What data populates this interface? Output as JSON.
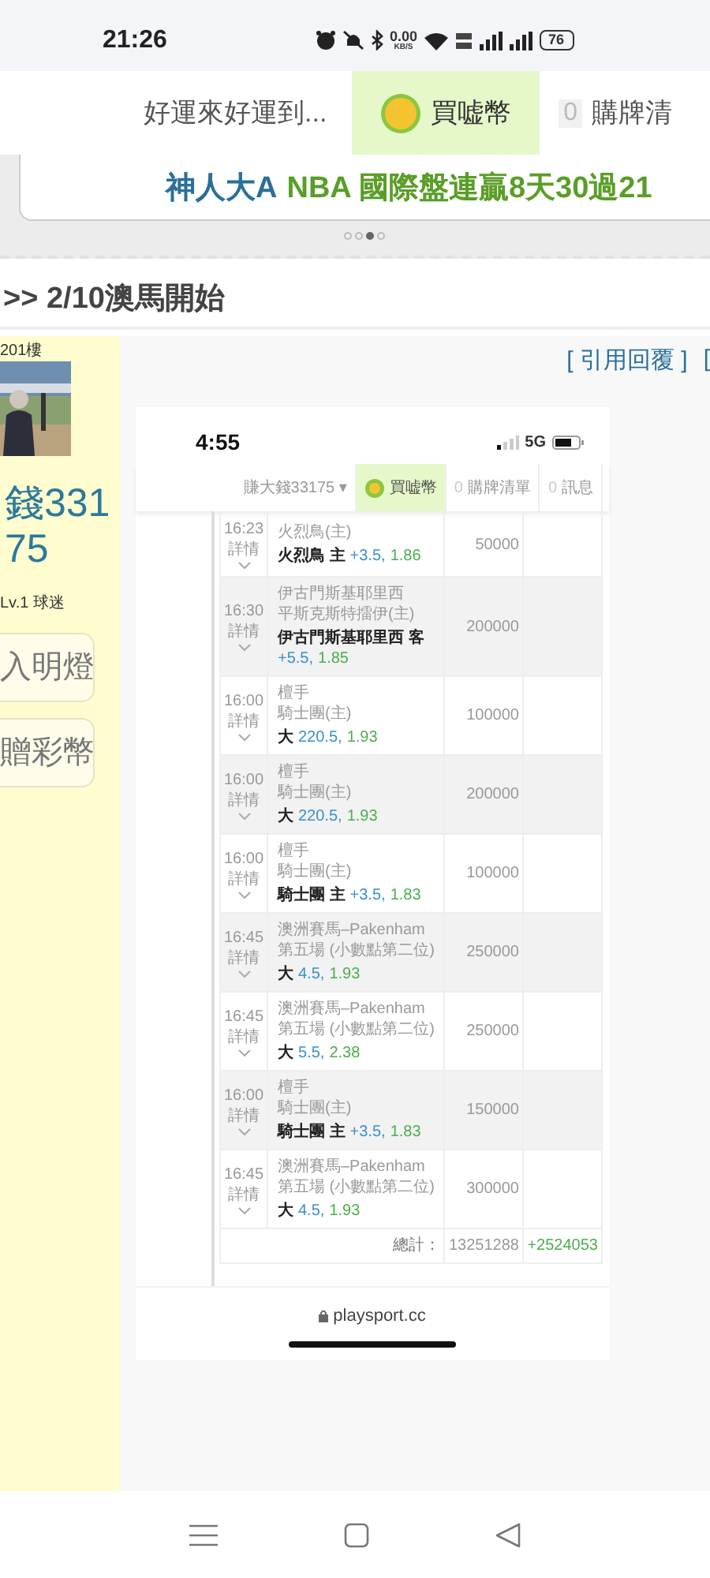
{
  "status_bar": {
    "time": "21:26",
    "speed": "0.00",
    "speed_unit": "KB/S",
    "battery": "76"
  },
  "nav": {
    "items": [
      {
        "kind": "text",
        "label": "好運來好運到..."
      },
      {
        "kind": "coin",
        "label": "買嘘幣"
      },
      {
        "kind": "count",
        "count": "0",
        "label": "購牌清"
      }
    ]
  },
  "banner": {
    "segments": [
      {
        "kind": "name",
        "text": "神人大A"
      },
      {
        "kind": "record",
        "text": "NBA 國際盤連贏8天30過21"
      }
    ],
    "dots": [
      {
        "selected": false
      },
      {
        "selected": false
      },
      {
        "selected": true
      },
      {
        "selected": false
      }
    ]
  },
  "thread_title": ">> 2/10澳馬開始",
  "post": {
    "floor": "201樓",
    "author": "錢33175",
    "rank": "Lv.1 球迷",
    "buttons": [
      "入明燈",
      "贈彩幣"
    ],
    "actions": [
      "[ 引用回覆 ]",
      "["
    ],
    "screenshot": {
      "time": "4:55",
      "network": "5G",
      "nav": {
        "user": "賺大錢33175",
        "user_caret": "▾",
        "coin": "買嘘幣",
        "items": [
          {
            "count": "0",
            "label": "購牌清單"
          },
          {
            "count": "0",
            "label": "訊息"
          }
        ]
      },
      "rows": [
        {
          "time": "16:23",
          "detail": "詳情",
          "event": [
            "火烈鳥(主)"
          ],
          "pick": "火烈鳥 主",
          "handicap": "+3.5,",
          "odds": "1.86",
          "amount": "50000"
        },
        {
          "time": "16:30",
          "detail": "詳情",
          "event": [
            "伊古門斯基耶里西",
            "平斯克斯特擂伊(主)"
          ],
          "pick": "伊古門斯基耶里西 客",
          "handicap": "+5.5,",
          "odds": "1.85",
          "amount": "200000"
        },
        {
          "time": "16:00",
          "detail": "詳情",
          "event": [
            "檀手",
            "騎士團(主)"
          ],
          "pick": "大",
          "handicap": "220.5,",
          "odds": "1.93",
          "amount": "100000"
        },
        {
          "time": "16:00",
          "detail": "詳情",
          "event": [
            "檀手",
            "騎士團(主)"
          ],
          "pick": "大",
          "handicap": "220.5,",
          "odds": "1.93",
          "amount": "200000"
        },
        {
          "time": "16:00",
          "detail": "詳情",
          "event": [
            "檀手",
            "騎士團(主)"
          ],
          "pick": "騎士團 主",
          "handicap": "+3.5,",
          "odds": "1.83",
          "amount": "100000"
        },
        {
          "time": "16:45",
          "detail": "詳情",
          "event": [
            "澳洲賽馬–Pakenham 第五場 (小數點第二位)"
          ],
          "pick": "大",
          "handicap": "4.5,",
          "odds": "1.93",
          "amount": "250000"
        },
        {
          "time": "16:45",
          "detail": "詳情",
          "event": [
            "澳洲賽馬–Pakenham 第五場 (小數點第二位)"
          ],
          "pick": "大",
          "handicap": "5.5,",
          "odds": "2.38",
          "amount": "250000"
        },
        {
          "time": "16:00",
          "detail": "詳情",
          "event": [
            "檀手",
            "騎士團(主)"
          ],
          "pick": "騎士團 主",
          "handicap": "+3.5,",
          "odds": "1.83",
          "amount": "150000"
        },
        {
          "time": "16:45",
          "detail": "詳情",
          "event": [
            "澳洲賽馬–Pakenham 第五場 (小數點第二位)"
          ],
          "pick": "大",
          "handicap": "4.5,",
          "odds": "1.93",
          "amount": "300000"
        }
      ],
      "total": {
        "label": "總計：",
        "amount": "13251288",
        "result": "+2524053"
      },
      "url": "playsport.cc"
    }
  }
}
